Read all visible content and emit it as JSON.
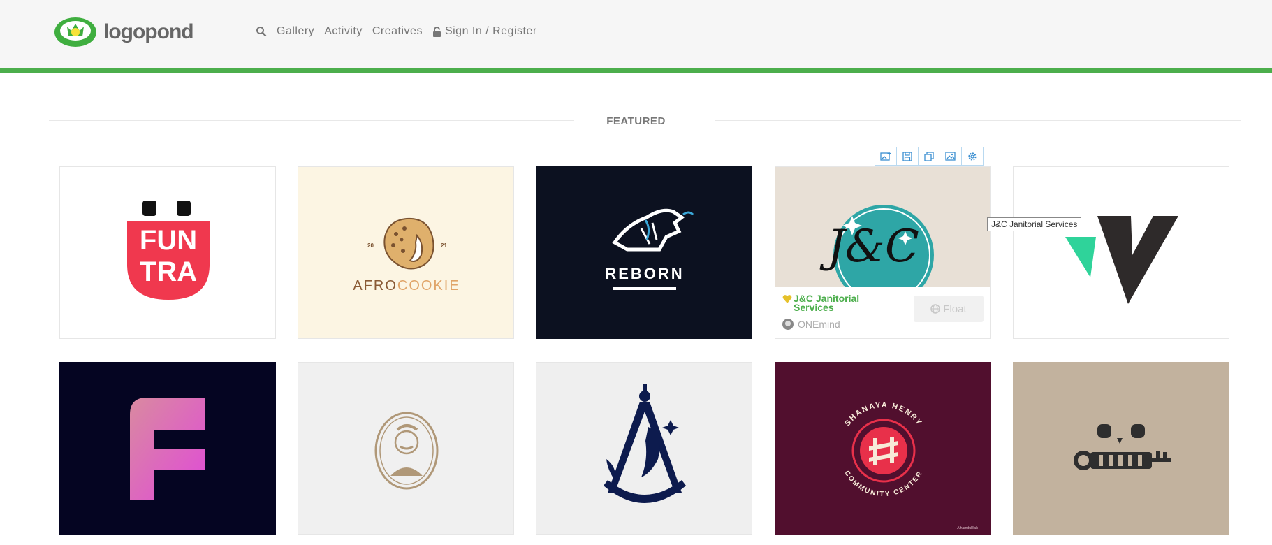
{
  "header": {
    "logo_text": "logopond",
    "nav": [
      {
        "label": "Gallery"
      },
      {
        "label": "Activity"
      },
      {
        "label": "Creatives"
      },
      {
        "label": "Sign In / Register"
      }
    ],
    "accent_color": "#4cae4c"
  },
  "section": {
    "title": "FEATURED"
  },
  "cards": [
    {
      "name": "funtra-logo",
      "bg": "#ffffff",
      "text": "FUN TRA"
    },
    {
      "name": "afrocookie-logo",
      "bg": "#fcf5e3",
      "text_a": "AFRO",
      "text_b": "COOKIE",
      "year_l": "20",
      "year_r": "21"
    },
    {
      "name": "reborn-logo",
      "bg": "#0c1120",
      "text": "REBORN"
    },
    {
      "name": "jc-janitorial-logo",
      "bg": "#e8e0d6"
    },
    {
      "name": "wv-logo",
      "bg": "#ffffff"
    },
    {
      "name": "f-gradient-logo",
      "bg": "#050522"
    },
    {
      "name": "gentleman-portrait-logo",
      "bg": "#f0f0f0"
    },
    {
      "name": "compass-mermaid-logo",
      "bg": "#efefef"
    },
    {
      "name": "shanaya-henry-logo",
      "bg": "#510f2e",
      "ring_top": "SHANAYA HENRY",
      "ring_bottom": "COMMUNITY CENTER",
      "credit": "Alhamdulillah"
    },
    {
      "name": "skull-key-logo",
      "bg": "#c2b29e"
    }
  ],
  "hover_card": {
    "title": "J&C Janitorial Services",
    "author": "ONEmind",
    "float_label": "Float",
    "tooltip": "J&C Janitorial Services",
    "toolbar_icons": [
      "image-add-icon",
      "save-icon",
      "copy-icon",
      "image-edit-icon",
      "gear-icon"
    ]
  }
}
